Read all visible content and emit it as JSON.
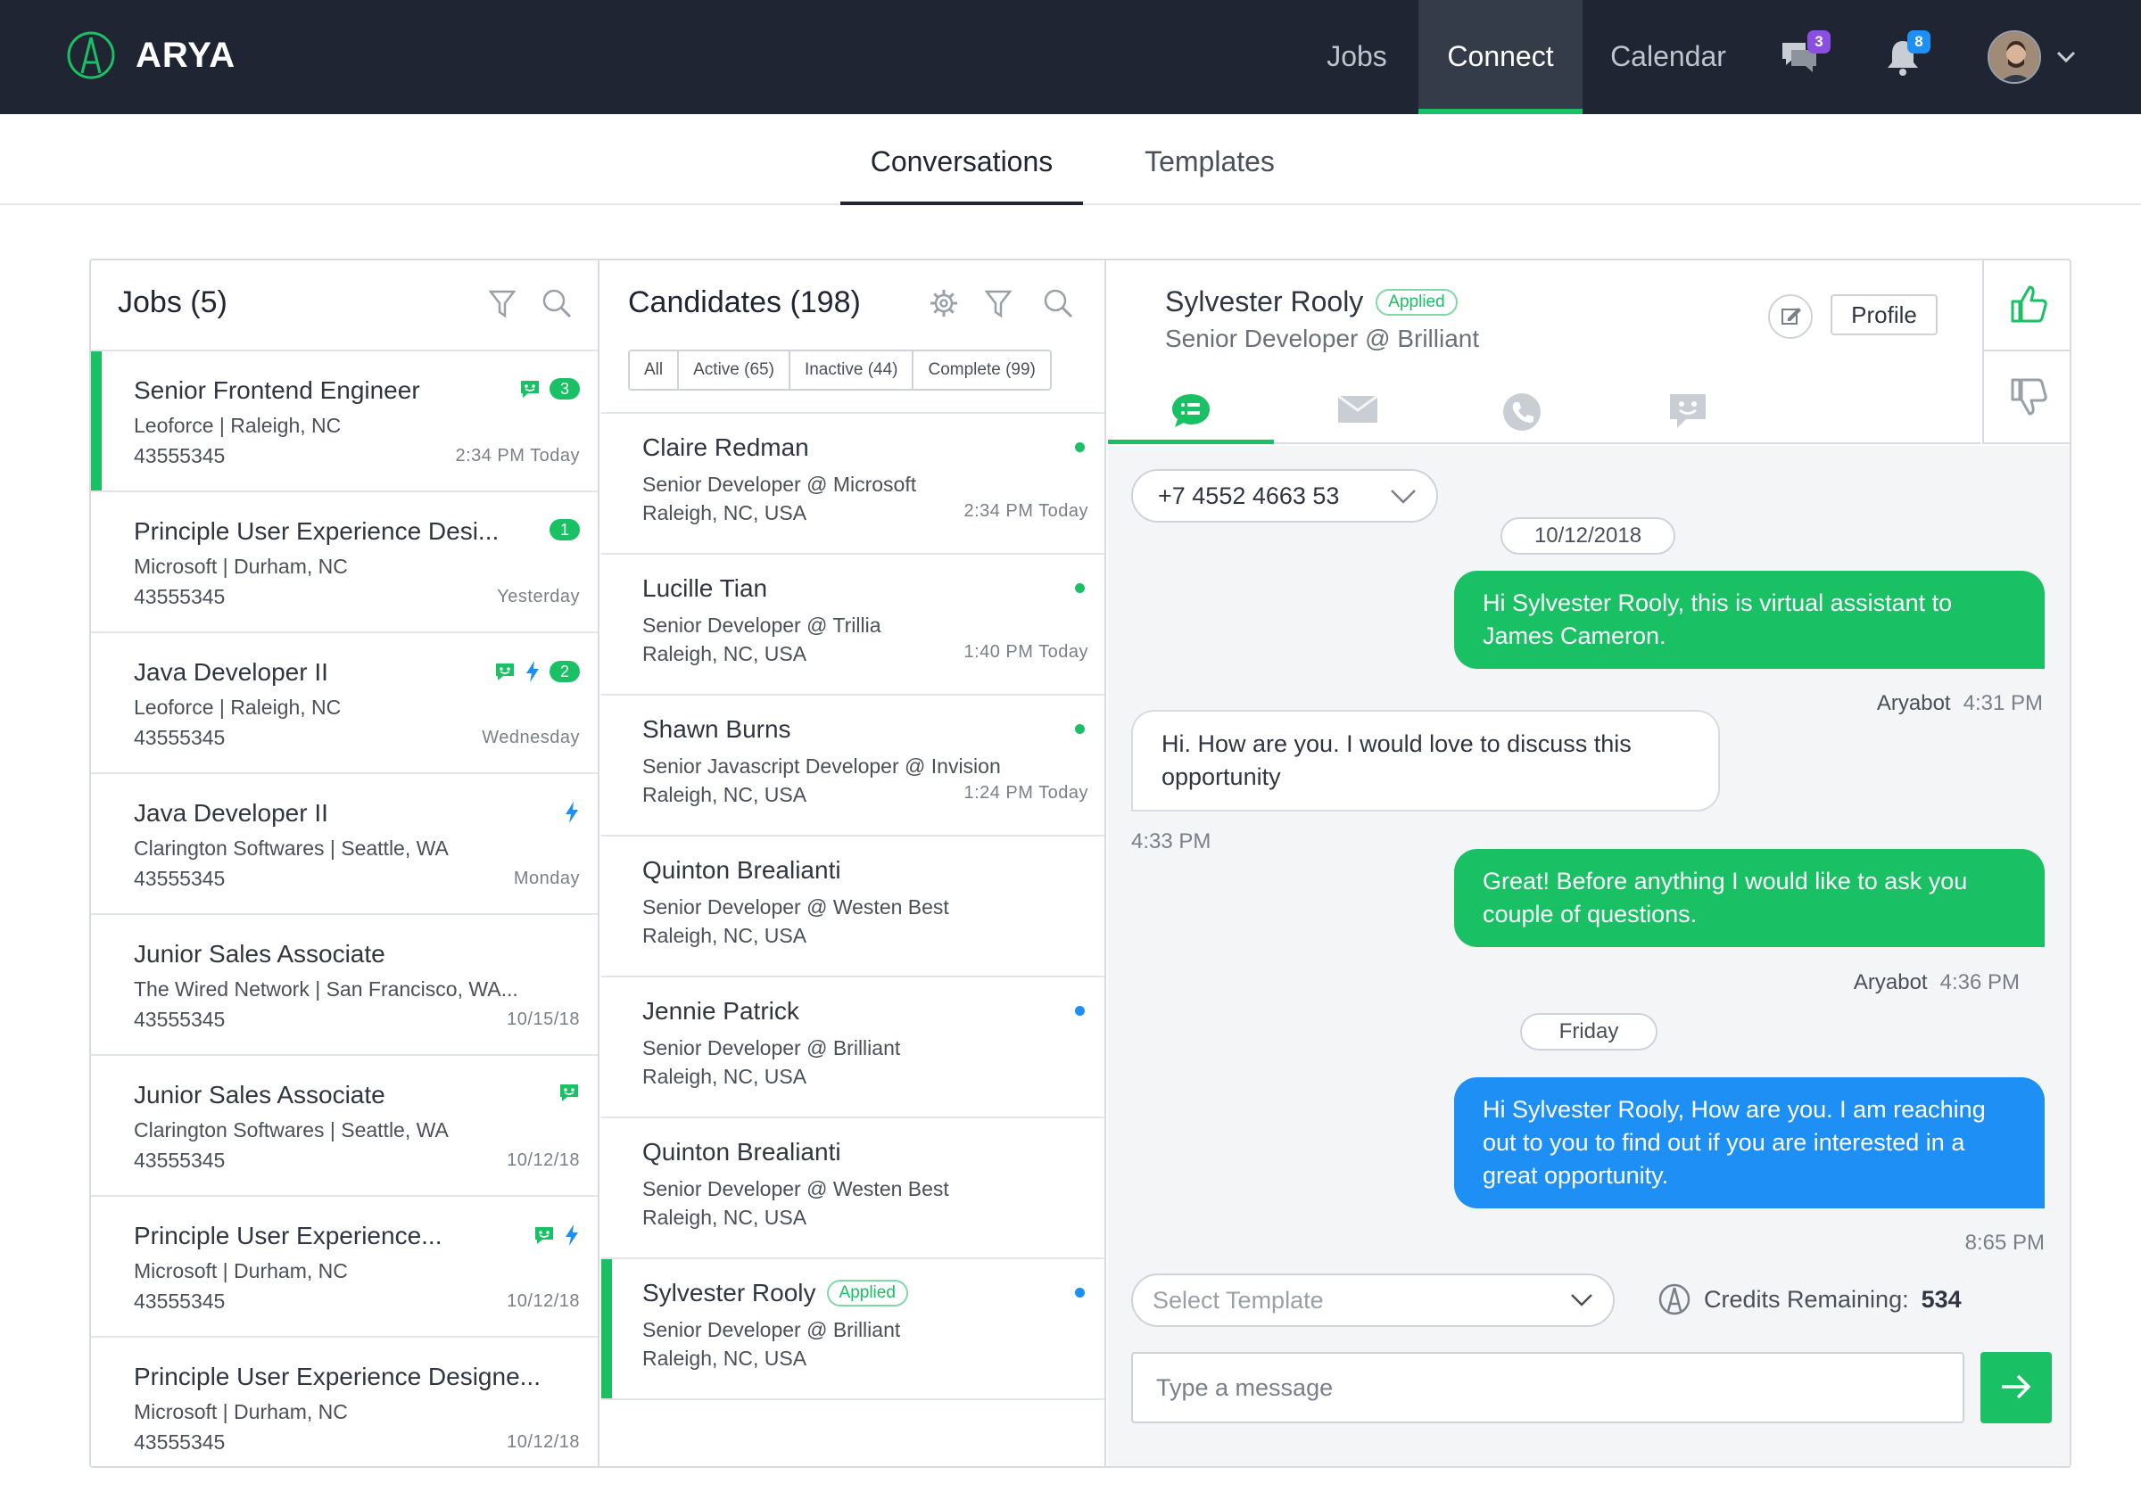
{
  "app": {
    "brand": "ARYA"
  },
  "nav": {
    "jobs": "Jobs",
    "connect": "Connect",
    "calendar": "Calendar",
    "messages_badge": "3",
    "notifications_badge": "8"
  },
  "subnav": {
    "conversations": "Conversations",
    "templates": "Templates"
  },
  "jobs_panel": {
    "title": "Jobs (5)",
    "items": [
      {
        "title": "Senior Frontend Engineer",
        "sub": "Leoforce | Raleigh, NC",
        "id": "43555345",
        "time": "2:34 PM Today",
        "count": "3"
      },
      {
        "title": "Principle User Experience Desi...",
        "sub": "Microsoft | Durham, NC",
        "id": "43555345",
        "time": "Yesterday",
        "count": "1"
      },
      {
        "title": "Java Developer II",
        "sub": "Leoforce | Raleigh, NC",
        "id": "43555345",
        "time": "Wednesday",
        "count": "2"
      },
      {
        "title": "Java Developer II",
        "sub": "Clarington Softwares | Seattle, WA",
        "id": "43555345",
        "time": "Monday"
      },
      {
        "title": "Junior Sales Associate",
        "sub": "The Wired Network | San Francisco, WA...",
        "id": "43555345",
        "time": "10/15/18"
      },
      {
        "title": "Junior Sales Associate",
        "sub": "Clarington Softwares | Seattle, WA",
        "id": "43555345",
        "time": "10/12/18"
      },
      {
        "title": "Principle User Experience...",
        "sub": "Microsoft | Durham, NC",
        "id": "43555345",
        "time": "10/12/18"
      },
      {
        "title": "Principle User Experience Designe...",
        "sub": "Microsoft | Durham, NC",
        "id": "43555345",
        "time": "10/12/18"
      }
    ]
  },
  "candidates_panel": {
    "title": "Candidates (198)",
    "filters": [
      "All",
      "Active (65)",
      "Inactive (44)",
      "Complete (99)"
    ],
    "items": [
      {
        "name": "Claire Redman",
        "role": "Senior Developer @ Microsoft",
        "loc": "Raleigh, NC, USA",
        "time": "2:34 PM Today"
      },
      {
        "name": "Lucille Tian",
        "role": "Senior Developer @ Trillia",
        "loc": "Raleigh, NC, USA",
        "time": "1:40 PM Today"
      },
      {
        "name": "Shawn Burns",
        "role": "Senior Javascript Developer @ Invision",
        "loc": "Raleigh, NC, USA",
        "time": "1:24 PM Today"
      },
      {
        "name": "Quinton Brealianti",
        "role": "Senior Developer @ Westen Best",
        "loc": "Raleigh, NC, USA",
        "time": ""
      },
      {
        "name": "Jennie Patrick",
        "role": "Senior Developer @ Brilliant",
        "loc": "Raleigh, NC, USA",
        "time": ""
      },
      {
        "name": "Quinton Brealianti",
        "role": "Senior Developer @ Westen Best",
        "loc": "Raleigh, NC, USA",
        "time": ""
      },
      {
        "name": "Sylvester Rooly",
        "role": "Senior Developer @ Brilliant",
        "loc": "Raleigh, NC, USA",
        "time": "",
        "tag": "Applied"
      }
    ]
  },
  "chat": {
    "name": "Sylvester Rooly",
    "tag": "Applied",
    "role": "Senior Developer @ Brilliant",
    "profile_label": "Profile",
    "phone": "+7 4552 4663 53",
    "messages": [
      {
        "date": "10/12/2018"
      },
      {
        "text": "Hi Sylvester Rooly, this is virtual assistant to James Cameron.",
        "sender": "Aryabot",
        "time": "4:31 PM"
      },
      {
        "text": "Hi. How are you. I would love to discuss this opportunity",
        "time": "4:33 PM"
      },
      {
        "text": "Great! Before anything I would like to ask you couple of questions.",
        "sender": "Aryabot",
        "time": "4:36 PM"
      },
      {
        "date": "Friday"
      },
      {
        "text": "Hi Sylvester Rooly, How are you. I am reaching out to you to find out if you are interested in a great opportunity.",
        "time": "8:65 PM"
      }
    ],
    "template_placeholder": "Select Template",
    "credits_label": "Credits Remaining:",
    "credits_value": "534",
    "input_placeholder": "Type a message"
  },
  "colors": {
    "brand_green": "#19c064",
    "topbar": "#1f2532",
    "outgoing_blue": "#1e8ff5",
    "badge_purple": "#8a4fe0",
    "badge_blue": "#1e8ff5"
  }
}
